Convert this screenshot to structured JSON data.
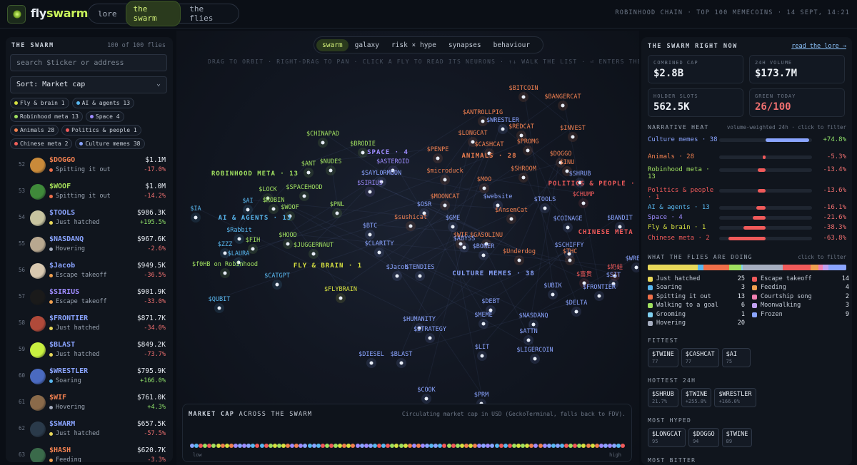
{
  "header": {
    "logo_text_a": "fly",
    "logo_text_b": "swarm",
    "logo_icon": "fly-logo-icon",
    "tabs": [
      {
        "label": "lore"
      },
      {
        "label": "the swarm",
        "active": true
      },
      {
        "label": "the flies"
      }
    ],
    "chain_info": "ROBINHOOD CHAIN · TOP 100 MEMECOINS · 14 SEPT, 14:21"
  },
  "left": {
    "title": "THE SWARM",
    "count": "100 of 100 flies",
    "search_placeholder": "search $ticker or address",
    "sort_label": "Sort: Market cap",
    "chips": [
      {
        "label": "Fly & brain 1",
        "color": "#d6e040"
      },
      {
        "label": "AI & agents 13",
        "color": "#59b8f0"
      },
      {
        "label": "Robinhood meta 13",
        "color": "#a0e060"
      },
      {
        "label": "Space 4",
        "color": "#9e8cff"
      },
      {
        "label": "Animals 28",
        "color": "#f08050"
      },
      {
        "label": "Politics & people 1",
        "color": "#f05a5a"
      },
      {
        "label": "Chinese meta 2",
        "color": "#f0605a"
      },
      {
        "label": "Culture memes 38",
        "color": "#8aa4ff"
      }
    ],
    "coins": [
      {
        "rank": "52",
        "ticker": "$DOGGO",
        "status": "Spitting it out",
        "sc": "#f0704a",
        "price": "$1.1M",
        "change": "-17.0%",
        "tc": "#f08050",
        "av": "#c98a3a",
        "up": false
      },
      {
        "rank": "53",
        "ticker": "$WOOF",
        "status": "Spitting it out",
        "sc": "#f0704a",
        "price": "$1.0M",
        "change": "-14.2%",
        "tc": "#a6e05a",
        "av": "#3f8a3a",
        "up": false
      },
      {
        "rank": "54",
        "ticker": "$TOOLS",
        "status": "Just hatched",
        "sc": "#e8d85a",
        "price": "$986.3K",
        "change": "+195.5%",
        "tc": "#8aa4ff",
        "av": "#c8c4a0",
        "up": true
      },
      {
        "rank": "55",
        "ticker": "$NASDANQ",
        "status": "Hovering",
        "sc": "#a6aec0",
        "price": "$967.6K",
        "change": "-2.6%",
        "tc": "#8aa4ff",
        "av": "#b8a890",
        "up": false
      },
      {
        "rank": "56",
        "ticker": "$Jacob",
        "status": "Escape takeoff",
        "sc": "#f0a050",
        "price": "$949.5K",
        "change": "-36.5%",
        "tc": "#8aa4ff",
        "av": "#d8c8b0",
        "up": false
      },
      {
        "rank": "57",
        "ticker": "$SIRIUS",
        "status": "Escape takeoff",
        "sc": "#f0a050",
        "price": "$901.9K",
        "change": "-33.0%",
        "tc": "#9e8cff",
        "av": "#1a1a1a",
        "up": false
      },
      {
        "rank": "58",
        "ticker": "$FRONTIER",
        "status": "Just hatched",
        "sc": "#e8d85a",
        "price": "$871.7K",
        "change": "-34.0%",
        "tc": "#8aa4ff",
        "av": "#b04a3a",
        "up": false
      },
      {
        "rank": "59",
        "ticker": "$BLAST",
        "status": "Just hatched",
        "sc": "#e8d85a",
        "price": "$849.2K",
        "change": "-73.7%",
        "tc": "#8aa4ff",
        "av": "#c8f040",
        "up": false
      },
      {
        "rank": "60",
        "ticker": "$WRESTLER",
        "status": "Soaring",
        "sc": "#59b8f0",
        "price": "$795.9K",
        "change": "+166.0%",
        "tc": "#8aa4ff",
        "av": "#4a6ac0",
        "up": true
      },
      {
        "rank": "61",
        "ticker": "$WIF",
        "status": "Hovering",
        "sc": "#a6aec0",
        "price": "$761.0K",
        "change": "+4.3%",
        "tc": "#f08050",
        "av": "#8a6a4a",
        "up": true
      },
      {
        "rank": "62",
        "ticker": "$SWARM",
        "status": "Just hatched",
        "sc": "#e8d85a",
        "price": "$657.5K",
        "change": "-57.5%",
        "tc": "#8aa4ff",
        "av": "#2a3a4a",
        "up": false
      },
      {
        "rank": "63",
        "ticker": "$HASH",
        "status": "Feeding",
        "sc": "#f0a050",
        "price": "$620.7K",
        "change": "-3.3%",
        "tc": "#f08050",
        "av": "#3a6a4a",
        "up": false
      }
    ]
  },
  "center": {
    "view_tabs": [
      {
        "label": "swarm",
        "active": true
      },
      {
        "label": "galaxy"
      },
      {
        "label": "risk × hype"
      },
      {
        "label": "synapses"
      },
      {
        "label": "behaviour"
      }
    ],
    "hint": "DRAG TO ORBIT · RIGHT-DRAG TO PAN · CLICK A FLY TO READ ITS NEURONS · ↑↓ WALK THE LIST · ⏎ ENTERS THE BRA",
    "clusters": [
      {
        "label": "ROBINHOOD META · 13",
        "color": "#a0e060"
      },
      {
        "label": "SPACE · 4",
        "color": "#9e8cff"
      },
      {
        "label": "ANIMALS · 28",
        "color": "#f08050"
      },
      {
        "label": "POLITICS & PEOPLE · 1",
        "color": "#f05a5a"
      },
      {
        "label": "AI & AGENTS · 13",
        "color": "#59b8f0"
      },
      {
        "label": "CHINESE META · 2",
        "color": "#f05a5a"
      },
      {
        "label": "FLY & BRAIN · 1",
        "color": "#d6e040"
      },
      {
        "label": "CULTURE MEMES · 38",
        "color": "#8aa4ff"
      }
    ],
    "fly_labels": [
      {
        "t": "$BITCOIN",
        "c": "#f08050"
      },
      {
        "t": "$BANGERCAT",
        "c": "#f08050"
      },
      {
        "t": "$ANTROLLPIG",
        "c": "#f08050"
      },
      {
        "t": "$WRESTLER",
        "c": "#8aa4ff"
      },
      {
        "t": "$REDCAT",
        "c": "#f08050"
      },
      {
        "t": "$INVEST",
        "c": "#f08050"
      },
      {
        "t": "$LONGCAT",
        "c": "#f08050"
      },
      {
        "t": "$CHINAPAD",
        "c": "#a0e060"
      },
      {
        "t": "$CASHCAT",
        "c": "#f08050"
      },
      {
        "t": "$PROMG",
        "c": "#f08050"
      },
      {
        "t": "$BRODIE",
        "c": "#a0e060"
      },
      {
        "t": "$PENPE",
        "c": "#f08050"
      },
      {
        "t": "$DOGGO",
        "c": "#f08050"
      },
      {
        "t": "$INU",
        "c": "#f08050"
      },
      {
        "t": "$NUDES",
        "c": "#a0e060"
      },
      {
        "t": "$ANT",
        "c": "#a0e060"
      },
      {
        "t": "$ASTEROID",
        "c": "#9e8cff"
      },
      {
        "t": "$SHROOM",
        "c": "#f08050"
      },
      {
        "t": "$SAYLORMOON",
        "c": "#8aa4ff"
      },
      {
        "t": "$microduck",
        "c": "#f08050"
      },
      {
        "t": "$SHRUB",
        "c": "#8aa4ff"
      },
      {
        "t": "$SIRIUS",
        "c": "#9e8cff"
      },
      {
        "t": "$MOO",
        "c": "#f08050"
      },
      {
        "t": "$CHUMP",
        "c": "#f05a5a"
      },
      {
        "t": "$SPACEHOOD",
        "c": "#a0e060"
      },
      {
        "t": "$LOCK",
        "c": "#a0e060"
      },
      {
        "t": "$MOONCAT",
        "c": "#f08050"
      },
      {
        "t": "$website",
        "c": "#8aa4ff"
      },
      {
        "t": "$TOOLS",
        "c": "#8aa4ff"
      },
      {
        "t": "$AI",
        "c": "#59b8f0"
      },
      {
        "t": "$ROBIN",
        "c": "#a0e060"
      },
      {
        "t": "$PNL",
        "c": "#a0e060"
      },
      {
        "t": "$OSR",
        "c": "#8aa4ff"
      },
      {
        "t": "$AnsemCat",
        "c": "#f08050"
      },
      {
        "t": "$IA",
        "c": "#59b8f0"
      },
      {
        "t": "$WOOF",
        "c": "#a0e060"
      },
      {
        "t": "$sushicat",
        "c": "#f08050"
      },
      {
        "t": "$COINAGE",
        "c": "#8aa4ff"
      },
      {
        "t": "$BANDIT",
        "c": "#8aa4ff"
      },
      {
        "t": "$GME",
        "c": "#8aa4ff"
      },
      {
        "t": "$Rabbit",
        "c": "#59b8f0"
      },
      {
        "t": "$BTC",
        "c": "#8aa4ff"
      },
      {
        "t": "$WIF",
        "c": "#f08050"
      },
      {
        "t": "$HOOD",
        "c": "#a0e060"
      },
      {
        "t": "$GASOLINU",
        "c": "#f08050"
      },
      {
        "t": "$FIH",
        "c": "#a0e060"
      },
      {
        "t": "$CLARITY",
        "c": "#8aa4ff"
      },
      {
        "t": "$ABYSS",
        "c": "#8aa4ff"
      },
      {
        "t": "$ZZZ",
        "c": "#59b8f0"
      },
      {
        "t": "$JUGGERNAUT",
        "c": "#a0e060"
      },
      {
        "t": "$BONER",
        "c": "#8aa4ff"
      },
      {
        "t": "$SCHIFFY",
        "c": "#8aa4ff"
      },
      {
        "t": "$LAURA",
        "c": "#59b8f0"
      },
      {
        "t": "$Underdog",
        "c": "#f08050"
      },
      {
        "t": "$THC",
        "c": "#f08050"
      },
      {
        "t": "$WREST",
        "c": "#8aa4ff"
      },
      {
        "t": "$f0HB on Robinhood",
        "c": "#a0e060"
      },
      {
        "t": "$Jacob",
        "c": "#8aa4ff"
      },
      {
        "t": "$TENDIES",
        "c": "#8aa4ff"
      },
      {
        "t": "$CATGPT",
        "c": "#59b8f0"
      },
      {
        "t": "$FLYBRAIN",
        "c": "#d6e040"
      },
      {
        "t": "$富贵",
        "c": "#f05a5a"
      },
      {
        "t": "$奶蛙",
        "c": "#f05a5a"
      },
      {
        "t": "$SIT",
        "c": "#8aa4ff"
      },
      {
        "t": "$FRONTIER",
        "c": "#8aa4ff"
      },
      {
        "t": "$UBIK",
        "c": "#8aa4ff"
      },
      {
        "t": "$QUBIT",
        "c": "#59b8f0"
      },
      {
        "t": "$DEBT",
        "c": "#8aa4ff"
      },
      {
        "t": "$DELTA",
        "c": "#8aa4ff"
      },
      {
        "t": "$MEME",
        "c": "#8aa4ff"
      },
      {
        "t": "$NASDANQ",
        "c": "#8aa4ff"
      },
      {
        "t": "$HUMANITY",
        "c": "#8aa4ff"
      },
      {
        "t": "$STRATEGY",
        "c": "#8aa4ff"
      },
      {
        "t": "$ATTN",
        "c": "#8aa4ff"
      },
      {
        "t": "$LIT",
        "c": "#8aa4ff"
      },
      {
        "t": "$LIGERCOIN",
        "c": "#8aa4ff"
      },
      {
        "t": "$DIESEL",
        "c": "#8aa4ff"
      },
      {
        "t": "$BLAST",
        "c": "#8aa4ff"
      },
      {
        "t": "$COOK",
        "c": "#8aa4ff"
      },
      {
        "t": "$PRM",
        "c": "#8aa4ff"
      }
    ],
    "mcap": {
      "title_a": "MARKET CAP",
      "title_b": "ACROSS THE SWARM",
      "note": "Circulating market cap in USD (GeckoTerminal, falls back to FDV).",
      "low": "low",
      "high": "high"
    }
  },
  "right": {
    "title": "THE SWARM RIGHT NOW",
    "link": "read the lore →",
    "stats": [
      {
        "label": "COMBINED CAP",
        "value": "$2.8B",
        "color": "#eef2f7"
      },
      {
        "label": "24H VOLUME",
        "value": "$173.7M",
        "color": "#eef2f7"
      },
      {
        "label": "HOLDER SLOTS",
        "value": "562.5K",
        "color": "#eef2f7"
      },
      {
        "label": "GREEN TODAY",
        "value": "26/100",
        "color": "#f07070"
      }
    ],
    "heat_title": "NARRATIVE HEAT",
    "heat_note": "volume-weighted 24h · click to filter",
    "heat": [
      {
        "name": "Culture memes · 38",
        "value": "+74.8%",
        "pct": 74.8,
        "color": "#8aa4ff",
        "up": true
      },
      {
        "name": "Animals · 28",
        "value": "-5.3%",
        "pct": 5.3,
        "color": "#f08050",
        "up": false
      },
      {
        "name": "Robinhood meta · 13",
        "value": "-13.4%",
        "pct": 13.4,
        "color": "#a0e060",
        "up": false
      },
      {
        "name": "Politics & people · 1",
        "value": "-13.6%",
        "pct": 13.6,
        "color": "#f05a5a",
        "up": false
      },
      {
        "name": "AI & agents · 13",
        "value": "-16.1%",
        "pct": 16.1,
        "color": "#59b8f0",
        "up": false
      },
      {
        "name": "Space · 4",
        "value": "-21.6%",
        "pct": 21.6,
        "color": "#9e8cff",
        "up": false
      },
      {
        "name": "Fly & brain · 1",
        "value": "-38.3%",
        "pct": 38.3,
        "color": "#d6e040",
        "up": false
      },
      {
        "name": "Chinese meta · 2",
        "value": "-63.8%",
        "pct": 63.8,
        "color": "#f05a5a",
        "up": false
      }
    ],
    "beh_title": "WHAT THE FLIES ARE DOING",
    "beh_note": "click to filter",
    "behaviours": [
      {
        "label": "Just hatched",
        "count": "25",
        "color": "#e8d85a"
      },
      {
        "label": "Soaring",
        "count": "3",
        "color": "#59b8f0"
      },
      {
        "label": "Spitting it out",
        "count": "13",
        "color": "#f0704a"
      },
      {
        "label": "Walking to a goal",
        "count": "6",
        "color": "#a0e060"
      },
      {
        "label": "Grooming",
        "count": "1",
        "color": "#7fd0f0"
      },
      {
        "label": "Hovering",
        "count": "20",
        "color": "#a6aec0"
      },
      {
        "label": "Escape takeoff",
        "count": "14",
        "color": "#f05a5a"
      },
      {
        "label": "Feeding",
        "count": "4",
        "color": "#f0a050"
      },
      {
        "label": "Courtship song",
        "count": "2",
        "color": "#f080b0"
      },
      {
        "label": "Moonwalking",
        "count": "3",
        "color": "#c0a0f0"
      },
      {
        "label": "Frozen",
        "count": "9",
        "color": "#8aa4ff"
      }
    ],
    "fittest_title": "FITTEST",
    "fittest": [
      {
        "t": "$TWINE",
        "s": "77"
      },
      {
        "t": "$CASHCAT",
        "s": "77"
      },
      {
        "t": "$AI",
        "s": "75"
      }
    ],
    "hottest_title": "HOTTEST 24H",
    "hottest": [
      {
        "t": "$SHRUB",
        "s": "21.7%"
      },
      {
        "t": "$TWINE",
        "s": "+255.8%"
      },
      {
        "t": "$WRESTLER",
        "s": "+166.0%"
      }
    ],
    "hyped_title": "MOST HYPED",
    "hyped": [
      {
        "t": "$LONGCAT",
        "s": "95"
      },
      {
        "t": "$DOGGO",
        "s": "94"
      },
      {
        "t": "$TWINE",
        "s": "89"
      }
    ],
    "bitter_title": "MOST BITTER"
  }
}
